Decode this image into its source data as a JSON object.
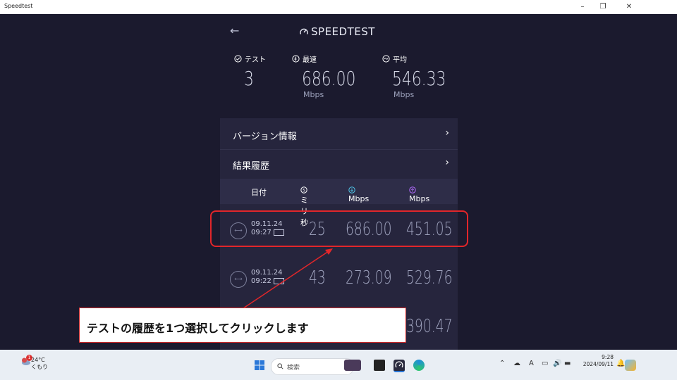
{
  "window": {
    "title": "Speedtest",
    "minimize": "–",
    "restore": "❐",
    "close": "✕"
  },
  "header": {
    "back_icon": "←",
    "logo_text": "SPEEDTEST"
  },
  "stats": [
    {
      "label": "テスト",
      "value": "3",
      "unit": ""
    },
    {
      "label": "最速",
      "value": "686.00",
      "unit": "Mbps"
    },
    {
      "label": "平均",
      "value": "546.33",
      "unit": "Mbps"
    }
  ],
  "menu": [
    {
      "label": "バージョン情報",
      "chevron": "›"
    },
    {
      "label": "結果履歴",
      "chevron": "›"
    }
  ],
  "table_header": {
    "date": "日付",
    "ping": "ミリ秒",
    "download": "Mbps",
    "upload": "Mbps"
  },
  "results": [
    {
      "date": "09.11.24",
      "time": "09:27",
      "ping": "25",
      "download": "686.00",
      "upload": "451.05"
    },
    {
      "date": "09.11.24",
      "time": "09:22",
      "ping": "43",
      "download": "273.09",
      "upload": "529.76"
    },
    {
      "date": "",
      "time": "",
      "ping": "",
      "download": "",
      "upload": "390.47"
    }
  ],
  "annotation": {
    "text": "テストの履歴を1つ選択してクリックします",
    "color": "#e2262a"
  },
  "taskbar": {
    "weather_temp": "24°C",
    "weather_desc": "くもり",
    "weather_badge": "1",
    "search_placeholder": "検索",
    "time": "9:28",
    "date": "2024/09/11",
    "tray_icons": [
      "chevron-up-icon",
      "cloud-icon",
      "ime-icon",
      "display-icon",
      "volume-icon",
      "battery-icon",
      "bell-icon"
    ],
    "ime_label": "A"
  },
  "colors": {
    "app_bg": "#1b1a2e",
    "panel_bg": "#26253d",
    "accent_red": "#e2262a",
    "download_icon": "#4fc3e6",
    "upload_icon": "#b36bff"
  }
}
